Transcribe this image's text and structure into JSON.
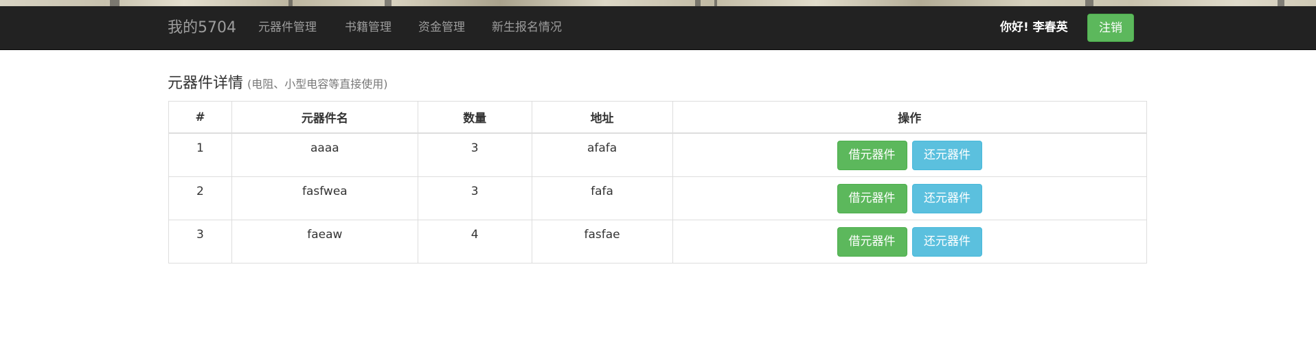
{
  "navbar": {
    "brand": "我的5704",
    "links": [
      "元器件管理",
      "书籍管理",
      "资金管理",
      "新生报名情况"
    ],
    "greeting": "你好! 李春英",
    "logout_label": "注销"
  },
  "section": {
    "title": "元器件详情",
    "subtitle": "(电阻、小型电容等直接使用)"
  },
  "table": {
    "headers": [
      "#",
      "元器件名",
      "数量",
      "地址",
      "操作"
    ],
    "rows": [
      {
        "id": "1",
        "name": "aaaa",
        "qty": "3",
        "addr": "afafa"
      },
      {
        "id": "2",
        "name": "fasfwea",
        "qty": "3",
        "addr": "fafa"
      },
      {
        "id": "3",
        "name": "faeaw",
        "qty": "4",
        "addr": "fasfae"
      }
    ],
    "borrow_label": "借元器件",
    "return_label": "还元器件"
  },
  "colors": {
    "navbar_bg": "#222222",
    "success": "#5cb85c",
    "info": "#5bc0de"
  }
}
